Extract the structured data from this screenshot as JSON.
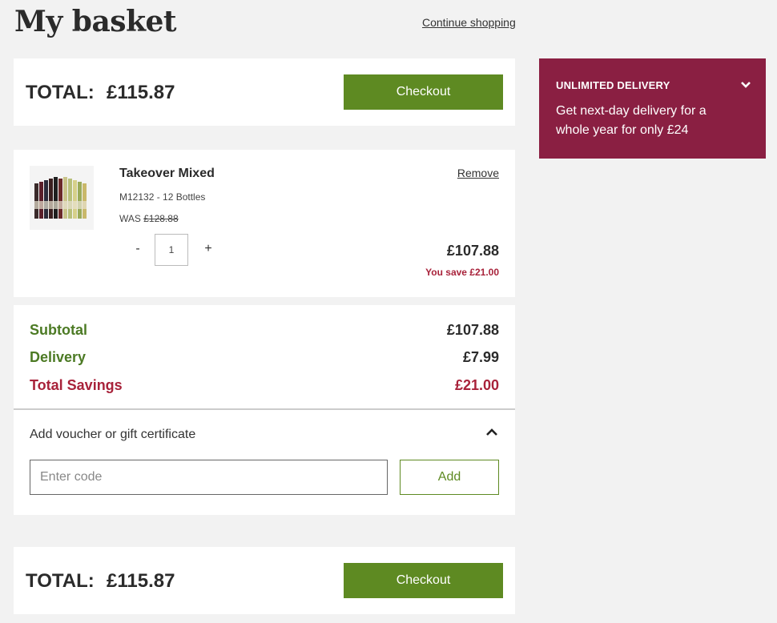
{
  "header": {
    "title": "My basket",
    "continue_link": "Continue shopping"
  },
  "total_bar": {
    "label": "TOTAL:",
    "value": "£115.87",
    "checkout_label": "Checkout"
  },
  "item": {
    "name": "Takeover Mixed",
    "code": "M12132 - 12 Bottles",
    "was_label": "WAS",
    "was_price": "£128.88",
    "remove_label": "Remove",
    "qty_minus": "-",
    "qty_plus": "+",
    "quantity": "1",
    "price": "£107.88",
    "savings": "You save £21.00"
  },
  "summary": {
    "subtotal_label": "Subtotal",
    "subtotal_value": "£107.88",
    "delivery_label": "Delivery",
    "delivery_value": "£7.99",
    "savings_label": "Total Savings",
    "savings_value": "£21.00"
  },
  "voucher": {
    "label": "Add voucher or gift certificate",
    "placeholder": "Enter code",
    "add_label": "Add"
  },
  "promo": {
    "title": "UNLIMITED DELIVERY",
    "text": "Get next-day delivery for a whole year for only £24"
  },
  "icons": {
    "voucher_toggle": "chevron-up-icon",
    "promo_toggle": "chevron-down-icon"
  },
  "colors": {
    "accent_green": "#5e8a22",
    "label_green": "#4c7a24",
    "savings_red": "#a8223a",
    "promo_bg": "#8a1f42",
    "background": "#f2f2f2"
  }
}
